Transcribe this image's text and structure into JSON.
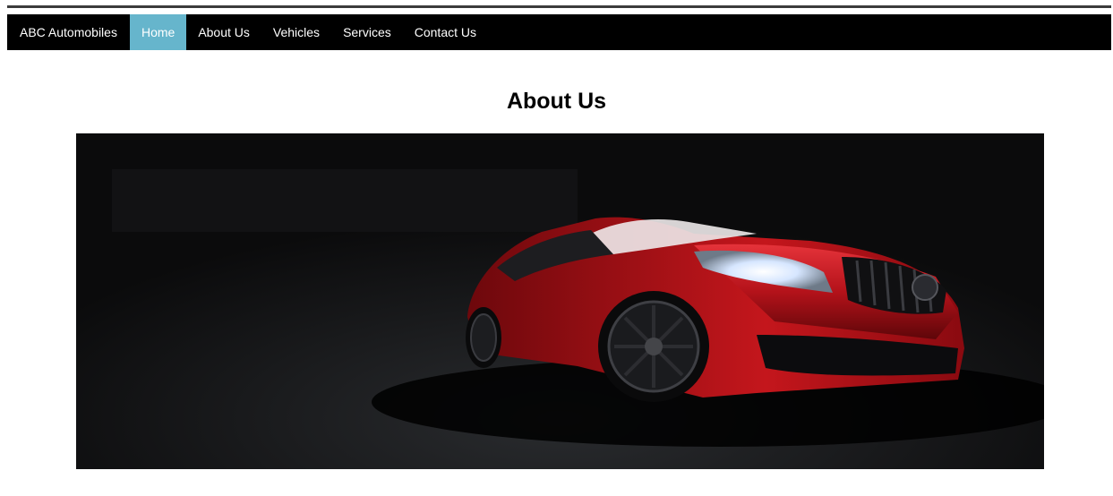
{
  "colors": {
    "accent": "#66b5cc",
    "navbar_bg": "#000000",
    "car_red": "#c4161c"
  },
  "navbar": {
    "brand": "ABC Automobiles",
    "items": [
      {
        "label": "Home",
        "active": true
      },
      {
        "label": "About Us",
        "active": false
      },
      {
        "label": "Vehicles",
        "active": false
      },
      {
        "label": "Services",
        "active": false
      },
      {
        "label": "Contact Us",
        "active": false
      }
    ]
  },
  "main": {
    "title": "About Us",
    "hero_image": "red-sports-car-photo"
  }
}
